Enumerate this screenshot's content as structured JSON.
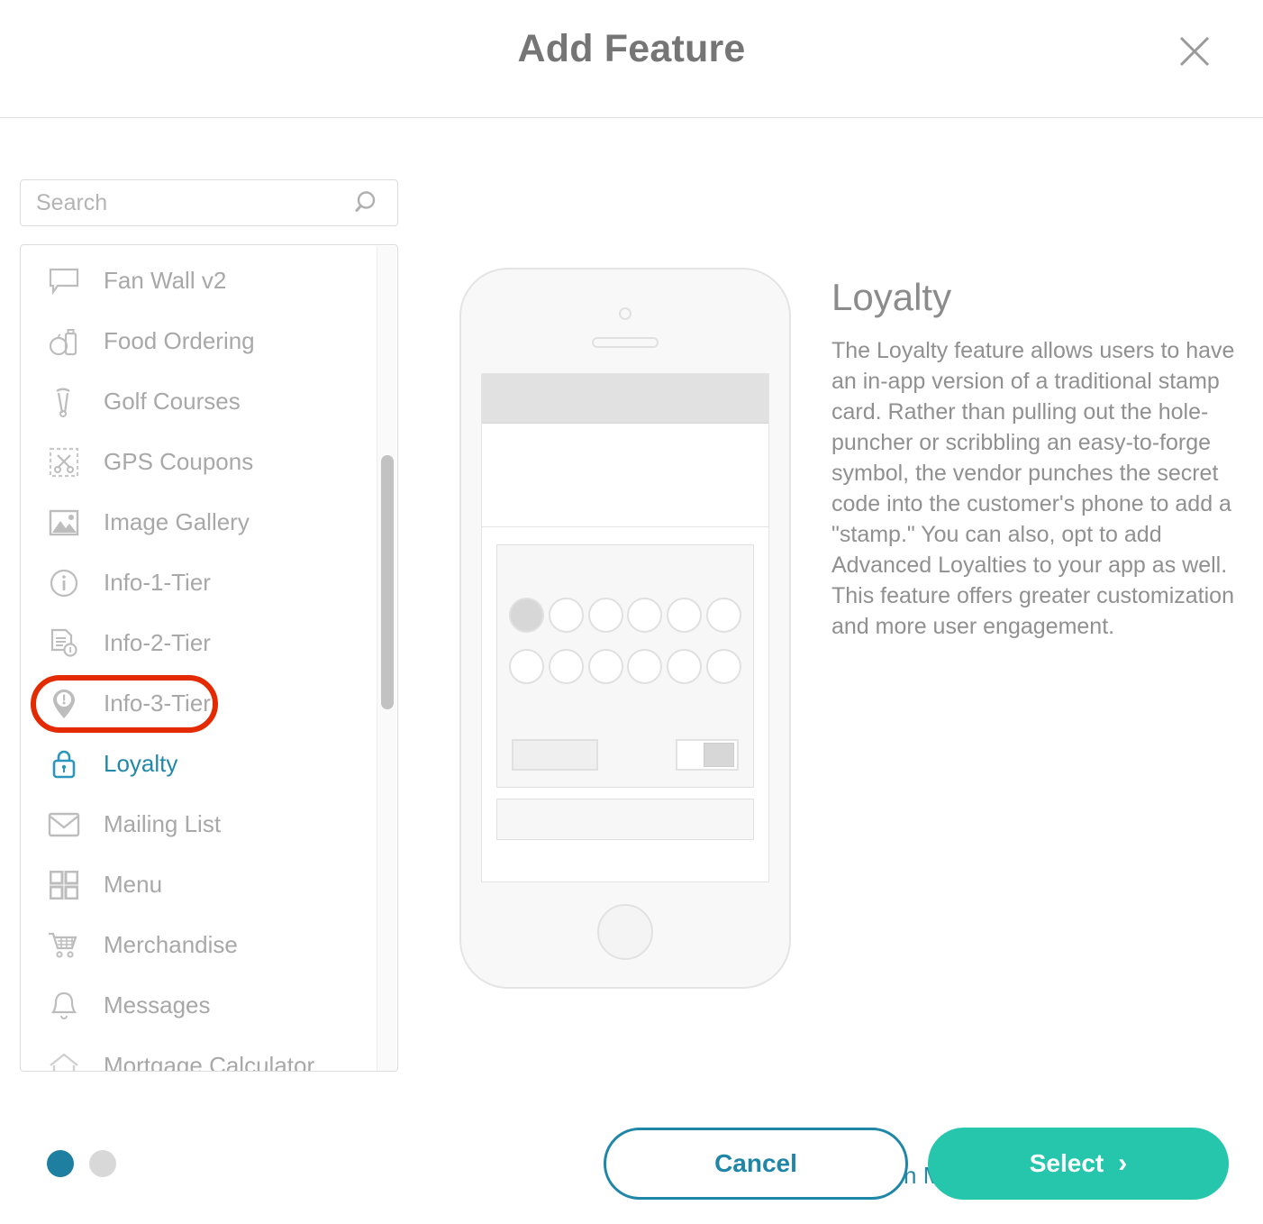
{
  "header": {
    "title": "Add Feature",
    "close_icon": "close-icon"
  },
  "search": {
    "placeholder": "Search",
    "value": "",
    "icon": "search-icon"
  },
  "feature_list": {
    "items": [
      {
        "label": "Fan Wall v2",
        "icon": "speech-bubble-icon",
        "selected": false
      },
      {
        "label": "Food Ordering",
        "icon": "food-icon",
        "selected": false
      },
      {
        "label": "Golf Courses",
        "icon": "golf-icon",
        "selected": false
      },
      {
        "label": "GPS Coupons",
        "icon": "scissors-icon",
        "selected": false
      },
      {
        "label": "Image Gallery",
        "icon": "image-icon",
        "selected": false
      },
      {
        "label": "Info-1-Tier",
        "icon": "info-circle-icon",
        "selected": false
      },
      {
        "label": "Info-2-Tier",
        "icon": "document-info-icon",
        "selected": false
      },
      {
        "label": "Info-3-Tier",
        "icon": "map-pin-icon",
        "selected": false
      },
      {
        "label": "Loyalty",
        "icon": "lock-icon",
        "selected": true
      },
      {
        "label": "Mailing List",
        "icon": "envelope-icon",
        "selected": false
      },
      {
        "label": "Menu",
        "icon": "grid-icon",
        "selected": false
      },
      {
        "label": "Merchandise",
        "icon": "shopping-cart-icon",
        "selected": false
      },
      {
        "label": "Messages",
        "icon": "bell-icon",
        "selected": false
      },
      {
        "label": "Mortgage Calculator",
        "icon": "home-icon",
        "selected": false
      }
    ]
  },
  "preview": {
    "device": "iphone-mockup",
    "stamps_total": 12,
    "stamps_filled": 1
  },
  "info": {
    "title": "Loyalty",
    "description": "The Loyalty feature allows users to have an in-app version of a traditional stamp card. Rather than pulling out the hole-puncher or scribbling an easy-to-forge symbol, the vendor punches the secret code into the customer's phone to add a \"stamp.\" You can also, opt to add Advanced Loyalties to your app as well. This feature offers greater customization and more user engagement.",
    "learn_more_label": "Learn More"
  },
  "footer": {
    "cancel_label": "Cancel",
    "select_label": "Select",
    "select_chevron": "›",
    "pager": {
      "total": 2,
      "active_index": 0
    }
  },
  "colors": {
    "accent_teal": "#26c6ac",
    "accent_blue": "#1f86a8",
    "link_blue": "#2288aa",
    "annotation_red": "#e32a00",
    "text_grey": "#909090",
    "dot_active": "#1f7fa0",
    "dot_inactive": "#d8d8d8"
  }
}
